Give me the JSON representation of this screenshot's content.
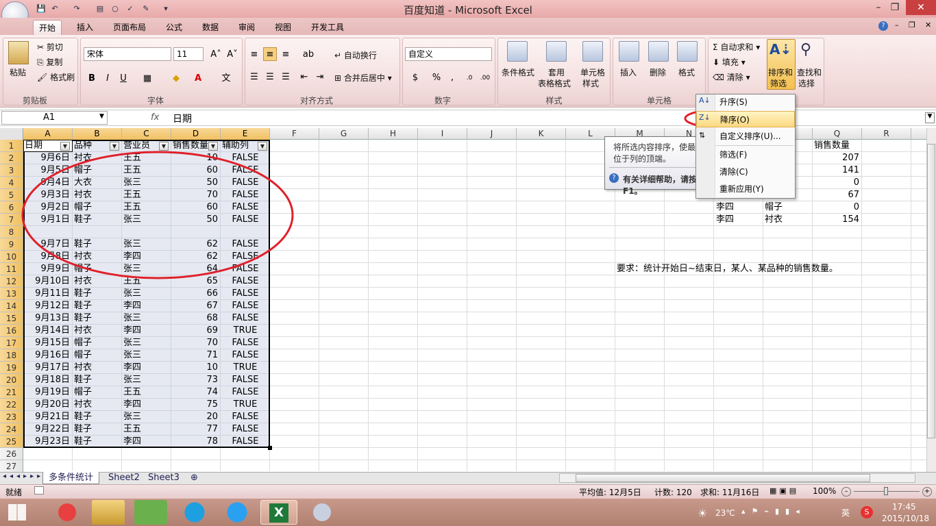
{
  "window": {
    "title": "百度知道 - Microsoft Excel",
    "minimize": "–",
    "restore": "❐",
    "close": "✕"
  },
  "ribbon": {
    "tabs": [
      "开始",
      "插入",
      "页面布局",
      "公式",
      "数据",
      "审阅",
      "视图",
      "开发工具"
    ],
    "help": "?",
    "clipboard": {
      "paste": "粘贴",
      "cut": "剪切",
      "copy": "复制",
      "format_painter": "格式刷",
      "label": "剪贴板"
    },
    "font": {
      "name": "宋体",
      "size": "11",
      "grow": "A˄",
      "shrink": "A˅",
      "bold": "B",
      "italic": "I",
      "underline": "U",
      "label": "字体"
    },
    "align": {
      "wrap": "自动换行",
      "merge": "合并后居中",
      "label": "对齐方式"
    },
    "number": {
      "format": "自定义",
      "percent": "%",
      "comma": ",",
      "label": "数字"
    },
    "styles": {
      "cond": "条件格式",
      "table": "套用",
      "table2": "表格格式",
      "cell": "单元格",
      "cell2": "样式",
      "label": "样式"
    },
    "cells": {
      "insert": "插入",
      "delete": "删除",
      "format": "格式",
      "label": "单元格"
    },
    "editing": {
      "autosum": "自动求和",
      "fill": "填充",
      "clear": "清除",
      "sort": "排序和",
      "sort2": "筛选",
      "find": "查找和",
      "find2": "选择"
    }
  },
  "formula_bar": {
    "name_box": "A1",
    "fx": "fx",
    "content": "日期"
  },
  "columns": [
    "A",
    "B",
    "C",
    "D",
    "E",
    "F",
    "G",
    "H",
    "I",
    "J",
    "K",
    "L",
    "M",
    "N",
    "O",
    "P",
    "Q",
    "R"
  ],
  "header": [
    "日期",
    "品种",
    "营业员",
    "销售数量",
    "辅助列"
  ],
  "rows": [
    [
      "9月6日",
      "衬衣",
      "王五",
      "10",
      "FALSE"
    ],
    [
      "9月5日",
      "帽子",
      "王五",
      "60",
      "FALSE"
    ],
    [
      "9月4日",
      "大衣",
      "张三",
      "50",
      "FALSE"
    ],
    [
      "9月3日",
      "衬衣",
      "王五",
      "70",
      "FALSE"
    ],
    [
      "9月2日",
      "帽子",
      "王五",
      "60",
      "FALSE"
    ],
    [
      "9月1日",
      "鞋子",
      "张三",
      "50",
      "FALSE"
    ],
    [
      "",
      "",
      "",
      "",
      ""
    ],
    [
      "9月7日",
      "鞋子",
      "张三",
      "62",
      "FALSE"
    ],
    [
      "9月8日",
      "衬衣",
      "李四",
      "62",
      "FALSE"
    ],
    [
      "9月9日",
      "帽子",
      "张三",
      "64",
      "FALSE"
    ],
    [
      "9月10日",
      "衬衣",
      "王五",
      "65",
      "FALSE"
    ],
    [
      "9月11日",
      "鞋子",
      "张三",
      "66",
      "FALSE"
    ],
    [
      "9月12日",
      "鞋子",
      "李四",
      "67",
      "FALSE"
    ],
    [
      "9月13日",
      "鞋子",
      "张三",
      "68",
      "FALSE"
    ],
    [
      "9月14日",
      "衬衣",
      "李四",
      "69",
      "TRUE"
    ],
    [
      "9月15日",
      "帽子",
      "张三",
      "70",
      "FALSE"
    ],
    [
      "9月16日",
      "帽子",
      "张三",
      "71",
      "FALSE"
    ],
    [
      "9月17日",
      "衬衣",
      "李四",
      "10",
      "TRUE"
    ],
    [
      "9月18日",
      "鞋子",
      "张三",
      "73",
      "FALSE"
    ],
    [
      "9月19日",
      "帽子",
      "王五",
      "74",
      "FALSE"
    ],
    [
      "9月20日",
      "衬衣",
      "李四",
      "75",
      "TRUE"
    ],
    [
      "9月21日",
      "鞋子",
      "张三",
      "20",
      "FALSE"
    ],
    [
      "9月22日",
      "鞋子",
      "王五",
      "77",
      "FALSE"
    ],
    [
      "9月23日",
      "鞋子",
      "李四",
      "78",
      "FALSE"
    ]
  ],
  "row_numbers": [
    "1",
    "2",
    "3",
    "4",
    "5",
    "6",
    "7",
    "8",
    "9",
    "10",
    "11",
    "12",
    "13",
    "14",
    "15",
    "16",
    "17",
    "18",
    "19",
    "20",
    "21",
    "22",
    "23",
    "24",
    "25",
    "26",
    "27"
  ],
  "side_table": {
    "header": "销售数量",
    "values": [
      "207",
      "141",
      "0",
      "67",
      "0",
      "154"
    ],
    "p_col": [
      "",
      "",
      "",
      "",
      "帽子",
      "衬衣"
    ],
    "o_col": [
      "",
      "",
      "",
      "",
      "李四",
      "李四"
    ],
    "p_partial": "帽子"
  },
  "requirement": "要求：统计开始日~结束日，某人、某品种的销售数量。",
  "sort_menu": {
    "asc": "升序(S)",
    "desc": "降序(O)",
    "custom": "自定义排序(U)...",
    "filter": "筛选(F)",
    "clear": "清除(C)",
    "reapply": "重新应用(Y)"
  },
  "tooltip": {
    "text1": "将所选内容排序，使最大值",
    "text2": "位于列的顶端。",
    "help": "有关详细帮助，请按 F1。"
  },
  "sheets": [
    "多条件统计",
    "Sheet2",
    "Sheet3"
  ],
  "status": {
    "ready": "就绪",
    "average": "平均值: 12月5日",
    "count": "计数: 120",
    "sum": "求和: 11月16日",
    "zoom": "100%"
  },
  "taskbar": {
    "temp": "23℃",
    "lang": "英",
    "time": "17:45",
    "date": "2015/10/18"
  },
  "colors": {
    "accent": "#e8a8a8",
    "annotation": "#e0202a"
  }
}
